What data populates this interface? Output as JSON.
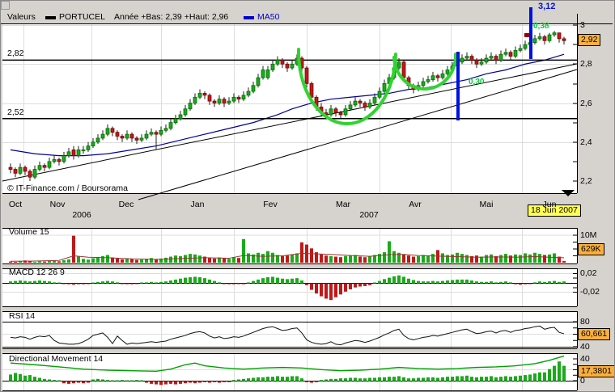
{
  "header": {
    "legend_label": "Valeurs",
    "series_name": "PORTUCEL",
    "range_text": "Année +Bas: 2,39 +Haut: 2,96",
    "ma_label": "MA50"
  },
  "annotations": {
    "target_price": "3,12",
    "fib_label_1": "0,38",
    "fib_label_2": "0,30",
    "support_upper_label": "2,82",
    "support_lower_label": "2,52",
    "last_price_badge": "2,92",
    "date_badge": "18 Jun 2007"
  },
  "panels": {
    "volume_title": "Volume 15",
    "macd_title": "MACD 12 26 9",
    "rsi_title": "RSI 14",
    "dm_title": "Directional Movement 14"
  },
  "axes": {
    "price_ticks": [
      "3",
      "2,8",
      "2,6",
      "2,4",
      "2,2"
    ],
    "months": [
      "Oct",
      "Nov",
      "Dec",
      "Jan",
      "Fev",
      "Mar",
      "Avr",
      "Mai",
      "Jun"
    ],
    "years": [
      "2006",
      "2007"
    ],
    "volume_tick": "10M",
    "volume_badge": "629K",
    "macd_ticks": [
      "0,02",
      "-0,02"
    ],
    "rsi_ticks": [
      "80",
      "40"
    ],
    "rsi_badge": "60,661",
    "dm_ticks": [
      "40",
      "0"
    ],
    "dm_badge": "17,3801"
  },
  "footer": {
    "copyright": "© IT-Finance.com / Boursorama"
  },
  "colors": {
    "app_bg": "#d6d3ce",
    "panel_bg": "#ffffff",
    "grid": "#dddddd",
    "axis": "#000000",
    "candle_up": "#1aaa1a",
    "candle_up_border": "#006600",
    "candle_down": "#c01818",
    "candle_down_border": "#700000",
    "ma50": "#000099",
    "volume_ma": "#993333",
    "rsi_line": "#111111",
    "adx_line": "#00a000",
    "arc_green": "#2fd42f",
    "vertical_blue": "#0011dd",
    "legend_blue": "#0000cc",
    "badge_orange": "#fbaf3c",
    "badge_yellow": "#ffff55",
    "label_green": "#00cc33",
    "marker_red": "#990000"
  },
  "chart_data": {
    "type": "candlestick",
    "title": "PORTUCEL",
    "price_ylim": [
      2.2,
      3.0
    ],
    "support_levels": [
      2.82,
      2.52
    ],
    "candles_ohlc": [
      [
        2.27,
        2.29,
        2.24,
        2.26
      ],
      [
        2.26,
        2.27,
        2.22,
        2.24
      ],
      [
        2.24,
        2.29,
        2.23,
        2.27
      ],
      [
        2.27,
        2.28,
        2.23,
        2.25
      ],
      [
        2.25,
        2.26,
        2.2,
        2.22
      ],
      [
        2.22,
        2.28,
        2.21,
        2.26
      ],
      [
        2.26,
        2.3,
        2.25,
        2.28
      ],
      [
        2.28,
        2.29,
        2.25,
        2.27
      ],
      [
        2.27,
        2.32,
        2.26,
        2.3
      ],
      [
        2.3,
        2.33,
        2.29,
        2.31
      ],
      [
        2.31,
        2.32,
        2.28,
        2.3
      ],
      [
        2.3,
        2.35,
        2.29,
        2.33
      ],
      [
        2.33,
        2.37,
        2.32,
        2.35
      ],
      [
        2.36,
        2.38,
        2.31,
        2.33
      ],
      [
        2.33,
        2.38,
        2.32,
        2.36
      ],
      [
        2.36,
        2.38,
        2.34,
        2.36
      ],
      [
        2.36,
        2.4,
        2.35,
        2.38
      ],
      [
        2.38,
        2.42,
        2.37,
        2.4
      ],
      [
        2.4,
        2.44,
        2.39,
        2.42
      ],
      [
        2.42,
        2.46,
        2.41,
        2.44
      ],
      [
        2.44,
        2.49,
        2.43,
        2.47
      ],
      [
        2.47,
        2.48,
        2.43,
        2.45
      ],
      [
        2.45,
        2.46,
        2.41,
        2.43
      ],
      [
        2.43,
        2.44,
        2.4,
        2.42
      ],
      [
        2.42,
        2.46,
        2.41,
        2.44
      ],
      [
        2.44,
        2.45,
        2.4,
        2.42
      ],
      [
        2.42,
        2.43,
        2.39,
        2.41
      ],
      [
        2.41,
        2.44,
        2.4,
        2.42
      ],
      [
        2.42,
        2.46,
        2.41,
        2.44
      ],
      [
        2.44,
        2.47,
        2.43,
        2.45
      ],
      [
        2.45,
        2.46,
        2.36,
        2.44
      ],
      [
        2.44,
        2.48,
        2.43,
        2.46
      ],
      [
        2.46,
        2.49,
        2.45,
        2.47
      ],
      [
        2.47,
        2.52,
        2.46,
        2.5
      ],
      [
        2.5,
        2.54,
        2.49,
        2.52
      ],
      [
        2.52,
        2.56,
        2.51,
        2.54
      ],
      [
        2.54,
        2.59,
        2.53,
        2.57
      ],
      [
        2.57,
        2.62,
        2.56,
        2.6
      ],
      [
        2.6,
        2.65,
        2.59,
        2.63
      ],
      [
        2.63,
        2.67,
        2.62,
        2.65
      ],
      [
        2.65,
        2.66,
        2.62,
        2.64
      ],
      [
        2.64,
        2.65,
        2.59,
        2.61
      ],
      [
        2.61,
        2.62,
        2.58,
        2.6
      ],
      [
        2.6,
        2.64,
        2.59,
        2.62
      ],
      [
        2.62,
        2.63,
        2.58,
        2.6
      ],
      [
        2.6,
        2.63,
        2.59,
        2.61
      ],
      [
        2.61,
        2.65,
        2.6,
        2.63
      ],
      [
        2.63,
        2.64,
        2.6,
        2.62
      ],
      [
        2.62,
        2.66,
        2.61,
        2.64
      ],
      [
        2.64,
        2.68,
        2.63,
        2.66
      ],
      [
        2.66,
        2.71,
        2.65,
        2.69
      ],
      [
        2.69,
        2.75,
        2.68,
        2.73
      ],
      [
        2.73,
        2.79,
        2.72,
        2.77
      ],
      [
        2.73,
        2.79,
        2.72,
        2.77
      ],
      [
        2.77,
        2.82,
        2.76,
        2.8
      ],
      [
        2.8,
        2.84,
        2.79,
        2.82
      ],
      [
        2.82,
        2.83,
        2.78,
        2.8
      ],
      [
        2.8,
        2.81,
        2.76,
        2.78
      ],
      [
        2.78,
        2.82,
        2.77,
        2.8
      ],
      [
        2.8,
        2.85,
        2.79,
        2.83
      ],
      [
        2.83,
        2.84,
        2.75,
        2.78
      ],
      [
        2.78,
        2.79,
        2.68,
        2.7
      ],
      [
        2.7,
        2.71,
        2.61,
        2.63
      ],
      [
        2.63,
        2.64,
        2.56,
        2.58
      ],
      [
        2.58,
        2.6,
        2.53,
        2.55
      ],
      [
        2.55,
        2.57,
        2.52,
        2.54
      ],
      [
        2.54,
        2.59,
        2.53,
        2.57
      ],
      [
        2.57,
        2.58,
        2.53,
        2.55
      ],
      [
        2.55,
        2.56,
        2.52,
        2.54
      ],
      [
        2.54,
        2.59,
        2.53,
        2.57
      ],
      [
        2.57,
        2.61,
        2.56,
        2.59
      ],
      [
        2.59,
        2.63,
        2.58,
        2.61
      ],
      [
        2.61,
        2.62,
        2.58,
        2.6
      ],
      [
        2.6,
        2.61,
        2.56,
        2.58
      ],
      [
        2.58,
        2.62,
        2.57,
        2.6
      ],
      [
        2.6,
        2.65,
        2.59,
        2.63
      ],
      [
        2.63,
        2.68,
        2.62,
        2.66
      ],
      [
        2.66,
        2.72,
        2.65,
        2.7
      ],
      [
        2.7,
        2.75,
        2.69,
        2.73
      ],
      [
        2.73,
        2.8,
        2.72,
        2.78
      ],
      [
        2.78,
        2.83,
        2.77,
        2.81
      ],
      [
        2.81,
        2.82,
        2.71,
        2.73
      ],
      [
        2.73,
        2.74,
        2.67,
        2.69
      ],
      [
        2.69,
        2.7,
        2.65,
        2.67
      ],
      [
        2.67,
        2.71,
        2.66,
        2.69
      ],
      [
        2.69,
        2.73,
        2.68,
        2.71
      ],
      [
        2.71,
        2.74,
        2.7,
        2.72
      ],
      [
        2.72,
        2.76,
        2.71,
        2.74
      ],
      [
        2.74,
        2.75,
        2.71,
        2.73
      ],
      [
        2.73,
        2.77,
        2.72,
        2.75
      ],
      [
        2.75,
        2.79,
        2.74,
        2.77
      ],
      [
        2.77,
        2.81,
        2.76,
        2.79
      ],
      [
        2.79,
        2.83,
        2.78,
        2.81
      ],
      [
        2.81,
        2.85,
        2.8,
        2.83
      ],
      [
        2.83,
        2.86,
        2.82,
        2.84
      ],
      [
        2.84,
        2.85,
        2.8,
        2.82
      ],
      [
        2.82,
        2.83,
        2.78,
        2.8
      ],
      [
        2.8,
        2.83,
        2.79,
        2.81
      ],
      [
        2.81,
        2.85,
        2.8,
        2.83
      ],
      [
        2.83,
        2.86,
        2.82,
        2.84
      ],
      [
        2.84,
        2.85,
        2.8,
        2.82
      ],
      [
        2.82,
        2.87,
        2.81,
        2.85
      ],
      [
        2.85,
        2.88,
        2.84,
        2.86
      ],
      [
        2.86,
        2.87,
        2.82,
        2.84
      ],
      [
        2.84,
        2.89,
        2.83,
        2.87
      ],
      [
        2.87,
        2.9,
        2.86,
        2.88
      ],
      [
        2.88,
        2.92,
        2.87,
        2.9
      ],
      [
        2.9,
        2.93,
        2.89,
        2.91
      ],
      [
        2.91,
        2.95,
        2.9,
        2.93
      ],
      [
        2.93,
        2.96,
        2.92,
        2.94
      ],
      [
        2.94,
        2.95,
        2.9,
        2.92
      ],
      [
        2.92,
        2.96,
        2.91,
        2.95
      ],
      [
        2.95,
        2.97,
        2.94,
        2.96
      ],
      [
        2.96,
        2.96,
        2.91,
        2.93
      ],
      [
        2.93,
        2.94,
        2.9,
        2.92
      ]
    ],
    "ma50": [
      [
        0,
        2.36
      ],
      [
        5,
        2.34
      ],
      [
        10,
        2.33
      ],
      [
        15,
        2.33
      ],
      [
        20,
        2.34
      ],
      [
        25,
        2.36
      ],
      [
        30,
        2.38
      ],
      [
        35,
        2.41
      ],
      [
        40,
        2.44
      ],
      [
        45,
        2.47
      ],
      [
        50,
        2.5
      ],
      [
        55,
        2.54
      ],
      [
        58,
        2.57
      ],
      [
        62,
        2.6
      ],
      [
        66,
        2.62
      ],
      [
        70,
        2.63
      ],
      [
        74,
        2.64
      ],
      [
        78,
        2.65
      ],
      [
        82,
        2.67
      ],
      [
        86,
        2.68
      ],
      [
        90,
        2.7
      ],
      [
        94,
        2.72
      ],
      [
        98,
        2.75
      ],
      [
        102,
        2.77
      ],
      [
        106,
        2.8
      ],
      [
        110,
        2.82
      ],
      [
        114,
        2.85
      ]
    ],
    "volume_millions": [
      0.4,
      0.3,
      0.5,
      0.8,
      0.6,
      0.3,
      0.5,
      0.4,
      0.6,
      0.7,
      0.5,
      0.9,
      1.2,
      9.8,
      2.2,
      1.4,
      1.1,
      1.6,
      1.8,
      2.4,
      2.8,
      1.9,
      1.5,
      1.2,
      1.6,
      1.3,
      1.0,
      1.1,
      1.4,
      1.7,
      1.3,
      1.5,
      1.8,
      2.2,
      2.6,
      2.4,
      2.8,
      3.2,
      3.0,
      2.6,
      2.2,
      1.8,
      1.5,
      1.9,
      1.6,
      1.4,
      2.0,
      1.7,
      8.6,
      3.4,
      3.0,
      3.6,
      3.2,
      4.2,
      3.6,
      2.8,
      2.4,
      2.6,
      3.0,
      3.4,
      7.4,
      6.6,
      5.2,
      3.8,
      3.0,
      2.6,
      2.4,
      2.2,
      2.0,
      2.4,
      2.6,
      2.8,
      2.2,
      2.0,
      2.4,
      2.8,
      3.2,
      3.8,
      7.8,
      4.2,
      3.6,
      3.0,
      2.6,
      2.2,
      2.4,
      2.8,
      2.6,
      3.2,
      4.6,
      3.4,
      2.8,
      3.0,
      3.6,
      3.2,
      2.8,
      2.4,
      2.6,
      2.2,
      2.8,
      3.0,
      2.4,
      2.8,
      3.2,
      2.6,
      3.0,
      2.8,
      3.4,
      3.0,
      3.6,
      3.2,
      2.8,
      3.0,
      3.4,
      2.2,
      0.63
    ],
    "volume_ma": [
      [
        0,
        0.5
      ],
      [
        5,
        0.6
      ],
      [
        10,
        0.8
      ],
      [
        13,
        2.5
      ],
      [
        16,
        2.0
      ],
      [
        20,
        1.8
      ],
      [
        25,
        1.4
      ],
      [
        30,
        1.2
      ],
      [
        35,
        1.5
      ],
      [
        40,
        1.8
      ],
      [
        45,
        1.6
      ],
      [
        48,
        2.6
      ],
      [
        52,
        2.3
      ],
      [
        56,
        2.5
      ],
      [
        60,
        3.4
      ],
      [
        63,
        3.2
      ],
      [
        66,
        3.0
      ],
      [
        70,
        2.6
      ],
      [
        74,
        2.3
      ],
      [
        78,
        2.9
      ],
      [
        81,
        3.0
      ],
      [
        84,
        2.6
      ],
      [
        88,
        2.4
      ],
      [
        92,
        2.2
      ],
      [
        96,
        2.0
      ],
      [
        100,
        2.1
      ],
      [
        104,
        2.0
      ],
      [
        108,
        2.2
      ],
      [
        111,
        2.0
      ],
      [
        114,
        1.8
      ]
    ],
    "macd": [
      0.004,
      0.005,
      0.006,
      0.005,
      0.004,
      0.005,
      0.006,
      0.005,
      0.004,
      0.002,
      0.001,
      -0.001,
      -0.002,
      -0.003,
      -0.002,
      -0.002,
      -0.001,
      0.001,
      0.003,
      0.004,
      0.005,
      0.004,
      0.002,
      -0.001,
      -0.002,
      -0.002,
      -0.001,
      0.001,
      0.002,
      0.003,
      0.002,
      0.003,
      0.004,
      0.006,
      0.008,
      0.01,
      0.012,
      0.013,
      0.014,
      0.013,
      0.011,
      0.008,
      0.005,
      0.002,
      -0.001,
      -0.002,
      -0.002,
      -0.001,
      -0.002,
      0.002,
      0.005,
      0.008,
      0.011,
      0.013,
      0.014,
      0.012,
      0.01,
      0.009,
      0.01,
      0.011,
      0.006,
      -0.004,
      -0.014,
      -0.022,
      -0.028,
      -0.033,
      -0.036,
      -0.03,
      -0.024,
      -0.018,
      -0.013,
      -0.009,
      -0.007,
      -0.006,
      -0.004,
      0.001,
      0.005,
      0.009,
      0.012,
      0.015,
      0.017,
      0.014,
      0.01,
      0.007,
      0.005,
      0.004,
      0.004,
      0.005,
      0.004,
      0.005,
      0.006,
      0.007,
      0.008,
      0.008,
      0.008,
      0.006,
      0.004,
      0.003,
      0.003,
      0.004,
      0.002,
      0.003,
      0.004,
      0.002,
      -0.002,
      -0.003,
      -0.002,
      -0.001,
      0.002,
      0.004,
      0.003,
      0.004,
      0.005,
      0.003,
      0.004
    ],
    "rsi": [
      55,
      54,
      56,
      55,
      52,
      55,
      57,
      56,
      58,
      50,
      46,
      45,
      44,
      44,
      45,
      48,
      52,
      58,
      60,
      62,
      55,
      45,
      57,
      50,
      44,
      46,
      45,
      46,
      47,
      48,
      47,
      48,
      49,
      52,
      54,
      56,
      58,
      61,
      63,
      64,
      62,
      57,
      54,
      56,
      53,
      54,
      56,
      55,
      57,
      60,
      63,
      66,
      69,
      71,
      72,
      69,
      66,
      67,
      69,
      70,
      62,
      51,
      47,
      45,
      44,
      45,
      48,
      44,
      43,
      46,
      48,
      50,
      49,
      47,
      49,
      52,
      55,
      59,
      62,
      66,
      68,
      58,
      53,
      51,
      53,
      55,
      56,
      58,
      57,
      59,
      61,
      63,
      65,
      67,
      68,
      64,
      61,
      62,
      64,
      65,
      62,
      65,
      66,
      63,
      66,
      67,
      69,
      70,
      72,
      73,
      68,
      70,
      71,
      63,
      60.7
    ],
    "rsi_last": 60.661,
    "dm_histogram": [
      12,
      15,
      13,
      10,
      11,
      8,
      6,
      4,
      3,
      2,
      1,
      -4,
      -5,
      -4,
      -3,
      -4,
      -3,
      3,
      4,
      3,
      2,
      1,
      1,
      2,
      1,
      1,
      2,
      1,
      -3,
      -5,
      -6,
      -7,
      -6,
      -5,
      -6,
      -5,
      -4,
      -3,
      -4,
      -3,
      -2,
      -3,
      -2,
      -3,
      -2,
      -2,
      2,
      3,
      4,
      5,
      6,
      7,
      7,
      8,
      8,
      9,
      8,
      8,
      9,
      9,
      5,
      -2,
      -3,
      -2,
      2,
      3,
      4,
      4,
      5,
      5,
      6,
      6,
      5,
      5,
      6,
      6,
      7,
      7,
      8,
      8,
      9,
      7,
      5,
      5,
      6,
      6,
      7,
      7,
      6,
      7,
      8,
      8,
      9,
      9,
      10,
      8,
      7,
      8,
      8,
      9,
      7,
      8,
      9,
      8,
      9,
      10,
      11,
      12,
      14,
      16,
      16,
      22,
      28,
      36,
      28
    ],
    "adx": [
      [
        0,
        33
      ],
      [
        5,
        30
      ],
      [
        10,
        26
      ],
      [
        15,
        22
      ],
      [
        20,
        20
      ],
      [
        25,
        19
      ],
      [
        30,
        18
      ],
      [
        33,
        22
      ],
      [
        36,
        30
      ],
      [
        38,
        33
      ],
      [
        40,
        28
      ],
      [
        44,
        24
      ],
      [
        48,
        22
      ],
      [
        52,
        24
      ],
      [
        56,
        25
      ],
      [
        60,
        24
      ],
      [
        64,
        21
      ],
      [
        68,
        19
      ],
      [
        72,
        20
      ],
      [
        76,
        22
      ],
      [
        80,
        25
      ],
      [
        84,
        23
      ],
      [
        88,
        22
      ],
      [
        92,
        23
      ],
      [
        96,
        25
      ],
      [
        100,
        26
      ],
      [
        104,
        28
      ],
      [
        108,
        32
      ],
      [
        111,
        38
      ],
      [
        114,
        46
      ]
    ],
    "adx_last": 17.3801,
    "trend_lines": [
      [
        2,
        223,
        712,
        78
      ],
      [
        170,
        246,
        712,
        85
      ]
    ],
    "verticals": [
      [
        565,
        63,
        148
      ],
      [
        655,
        8,
        72
      ]
    ],
    "arcs": [
      [
        368,
        60,
        488,
        66,
        89
      ],
      [
        486,
        70,
        562,
        66,
        41
      ]
    ],
    "marker": [
      647,
      40
    ]
  }
}
